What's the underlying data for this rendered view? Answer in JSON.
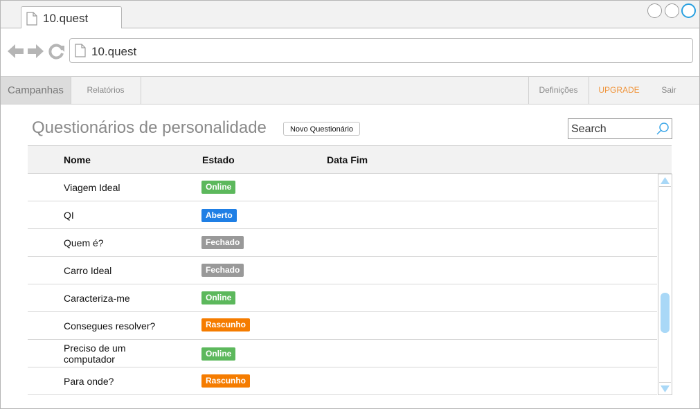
{
  "browser": {
    "tab_title": "10.quest",
    "url": "10.quest"
  },
  "nav": {
    "campanhas": "Campanhas",
    "relatorios": "Relatórios",
    "definicoes": "Definições",
    "upgrade": "UPGRADE",
    "sair": "Sair"
  },
  "page": {
    "title": "Questionários de personalidade",
    "new_button": "Novo Questionário",
    "search_placeholder": "Search"
  },
  "table": {
    "headers": {
      "nome": "Nome",
      "estado": "Estado",
      "data_fim": "Data Fim"
    },
    "rows": [
      {
        "nome": "Viagem Ideal",
        "estado": "Online",
        "data_fim": ""
      },
      {
        "nome": "QI",
        "estado": "Aberto",
        "data_fim": ""
      },
      {
        "nome": "Quem é?",
        "estado": "Fechado",
        "data_fim": ""
      },
      {
        "nome": "Carro Ideal",
        "estado": "Fechado",
        "data_fim": ""
      },
      {
        "nome": "Caracteriza-me",
        "estado": "Online",
        "data_fim": ""
      },
      {
        "nome": "Consegues resolver?",
        "estado": "Rascunho",
        "data_fim": ""
      },
      {
        "nome": "Preciso de um computador",
        "estado": "Online",
        "data_fim": ""
      },
      {
        "nome": "Para onde?",
        "estado": "Rascunho",
        "data_fim": ""
      }
    ]
  },
  "status_colors": {
    "Online": "#5cb85c",
    "Aberto": "#1f7fe5",
    "Fechado": "#999999",
    "Rascunho": "#f57c00"
  },
  "accent_color": "#f0943a",
  "scroll_position": 0.68
}
